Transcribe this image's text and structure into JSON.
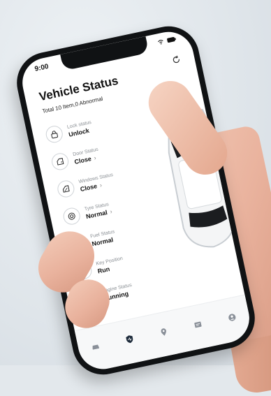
{
  "status_bar": {
    "time": "9:00",
    "icons": "wifi-icon battery-icon"
  },
  "header": {
    "title": "Vehicle Status",
    "subtitle": "Total 10 Item,0 Abnormal"
  },
  "items": [
    {
      "label": "Lock status",
      "value": "Unlock",
      "icon": "lock-icon",
      "chevron": false
    },
    {
      "label": "Door Status",
      "value": "Close",
      "icon": "door-icon",
      "chevron": true
    },
    {
      "label": "Windows Status",
      "value": "Close",
      "icon": "window-icon",
      "chevron": true
    },
    {
      "label": "Tyre Status",
      "value": "Normal",
      "icon": "tyre-icon",
      "chevron": true
    },
    {
      "label": "Fuel Status",
      "value": "Normal",
      "icon": "fuel-icon",
      "chevron": false
    },
    {
      "label": "Key Position",
      "value": "Run",
      "icon": "key-position-icon",
      "chevron": false
    },
    {
      "label": "Engine Status",
      "value": "Running",
      "icon": "engine-icon",
      "chevron": false
    }
  ],
  "tabs": [
    {
      "icon": "car-tab-icon"
    },
    {
      "icon": "status-shield-tab-icon",
      "active": true
    },
    {
      "icon": "location-tab-icon"
    },
    {
      "icon": "message-tab-icon"
    },
    {
      "icon": "profile-tab-icon"
    }
  ],
  "colors": {
    "accent": "#1c2a3a",
    "text": "#111111",
    "muted": "#8a8f94"
  }
}
